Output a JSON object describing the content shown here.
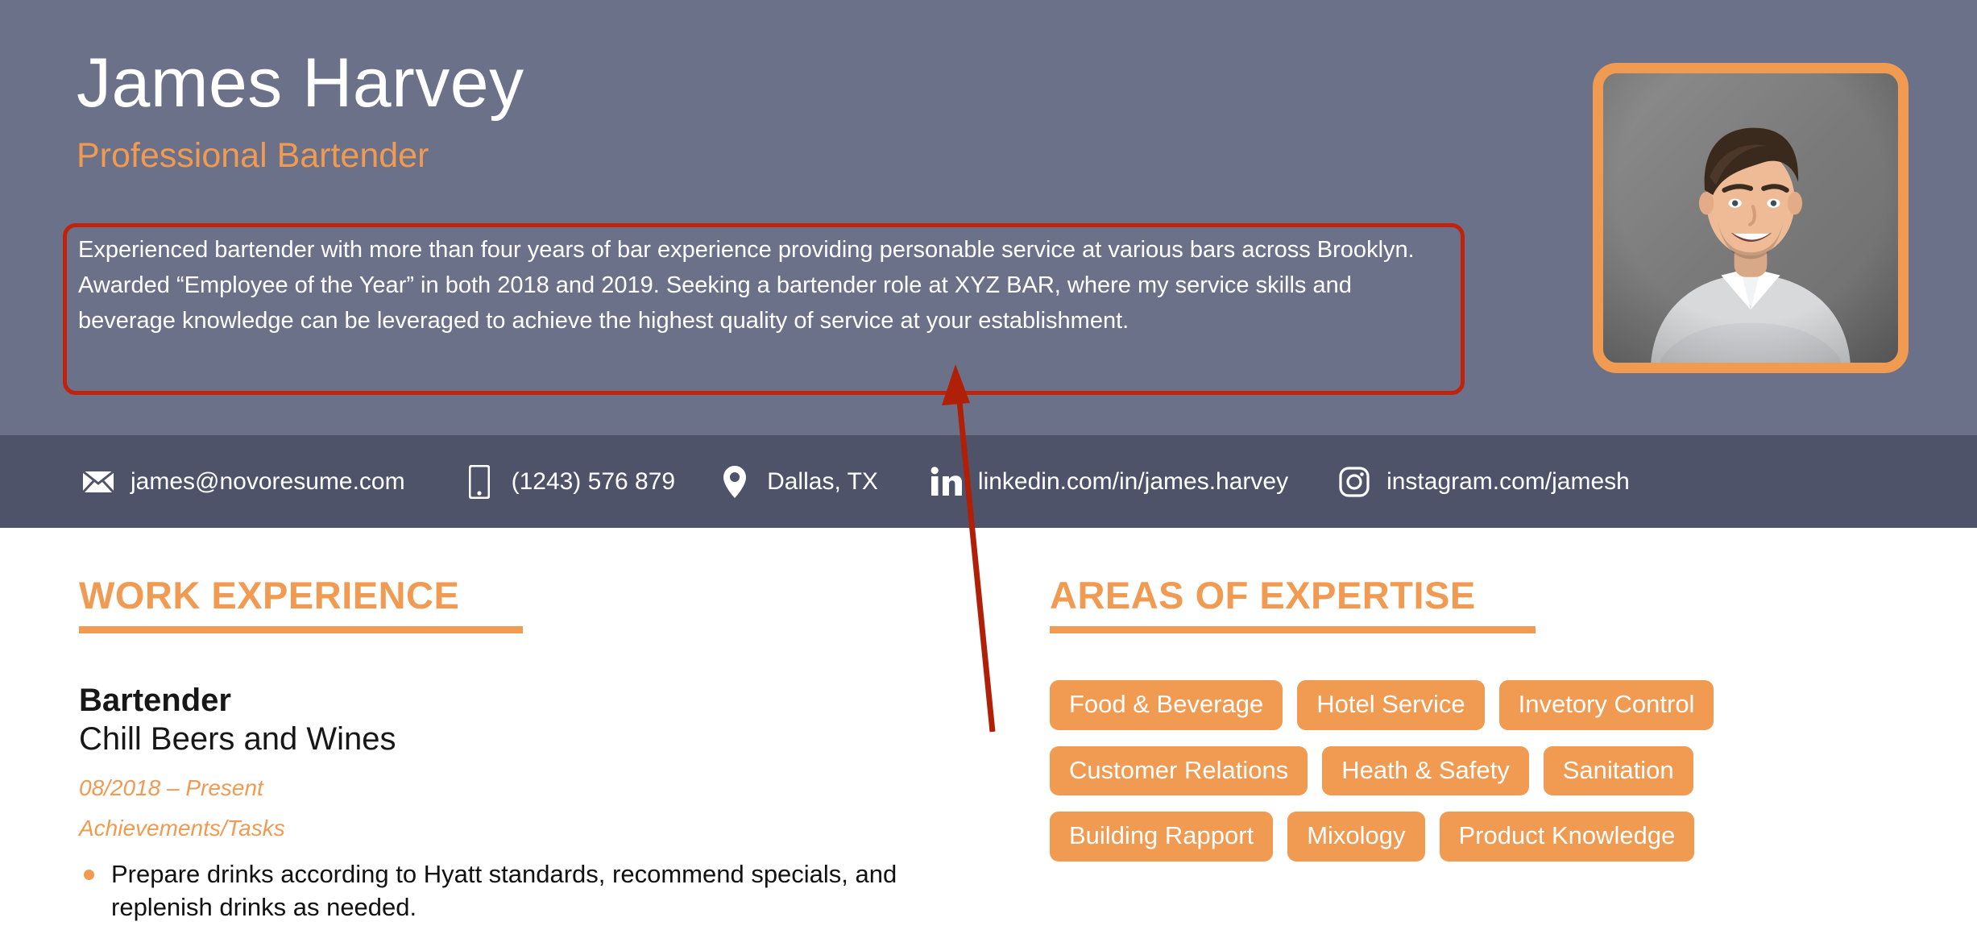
{
  "header": {
    "name": "James Harvey",
    "job_title": "Professional Bartender",
    "summary": "Experienced bartender with more than four years of bar experience providing personable service at various bars across Brooklyn. Awarded “Employee of the Year” in both 2018 and 2019. Seeking a bartender role at XYZ BAR, where my service skills and beverage knowledge can be leveraged to achieve the highest quality of service at your establishment.",
    "photo_alt": "Smiling man with arms crossed wearing grey sweater",
    "background_color": "#6b7188",
    "accent_color": "#f09a52",
    "highlight_box_color": "#c0220c"
  },
  "contact": {
    "items": [
      {
        "icon": "envelope-icon",
        "label": "james@novoresume.com"
      },
      {
        "icon": "mobile-phone-icon",
        "label": "(1243) 576 879"
      },
      {
        "icon": "map-pin-icon",
        "label": "Dallas, TX"
      },
      {
        "icon": "linkedin-icon",
        "label": "linkedin.com/in/james.harvey"
      },
      {
        "icon": "instagram-icon",
        "label": "instagram.com/jamesh"
      }
    ],
    "background_color": "#4e5369"
  },
  "work_experience": {
    "section_title": "WORK EXPERIENCE",
    "entries": [
      {
        "role": "Bartender",
        "company": "Chill Beers and Wines",
        "dates": "08/2018 – Present",
        "subheading": "Achievements/Tasks",
        "bullets": [
          "Prepare drinks according to Hyatt standards, recommend specials, and replenish drinks as needed."
        ]
      }
    ]
  },
  "areas_of_expertise": {
    "section_title": "AREAS OF EXPERTISE",
    "tags": [
      "Food & Beverage",
      "Hotel Service",
      "Invetory Control",
      "Customer Relations",
      "Heath & Safety",
      "Sanitation",
      "Building Rapport",
      "Mixology",
      "Product Knowledge"
    ],
    "tag_color": "#f09a52"
  },
  "annotation": {
    "type": "arrow",
    "color": "#b02008",
    "points_to": "summary-highlight-box"
  }
}
